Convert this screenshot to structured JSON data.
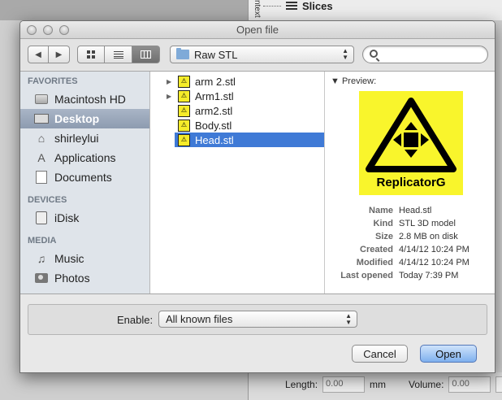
{
  "background": {
    "slices_label": "Slices",
    "vertical_tab": "ntext",
    "length_label": "Length:",
    "length_value": "0.00",
    "length_unit": "mm",
    "volume_label": "Volume:",
    "volume_value": "0.00",
    "cut_text": "cr"
  },
  "dialog": {
    "title": "Open file",
    "location": "Raw STL",
    "search_placeholder": ""
  },
  "sidebar": {
    "sections": [
      {
        "heading": "FAVORITES",
        "items": [
          "Macintosh HD",
          "Desktop",
          "shirleylui",
          "Applications",
          "Documents"
        ]
      },
      {
        "heading": "DEVICES",
        "items": [
          "iDisk"
        ]
      },
      {
        "heading": "MEDIA",
        "items": [
          "Music",
          "Photos"
        ]
      }
    ]
  },
  "files": [
    {
      "name": "arm 2.stl",
      "expandable": true
    },
    {
      "name": "Arm1.stl",
      "expandable": true
    },
    {
      "name": "arm2.stl",
      "expandable": false
    },
    {
      "name": "Body.stl",
      "expandable": false
    },
    {
      "name": "Head.stl",
      "expandable": false,
      "selected": true
    }
  ],
  "preview": {
    "label": "Preview:",
    "image_text": "ReplicatorG",
    "meta": [
      {
        "key": "Name",
        "value": "Head.stl"
      },
      {
        "key": "Kind",
        "value": "STL 3D model"
      },
      {
        "key": "Size",
        "value": "2.8 MB on disk"
      },
      {
        "key": "Created",
        "value": "4/14/12 10:24 PM"
      },
      {
        "key": "Modified",
        "value": "4/14/12 10:24 PM"
      },
      {
        "key": "Last opened",
        "value": "Today 7:39 PM"
      }
    ]
  },
  "filter": {
    "label": "Enable:",
    "value": "All known files"
  },
  "buttons": {
    "cancel": "Cancel",
    "open": "Open"
  },
  "colors": {
    "selection": "#3f7ad6",
    "sidebar_selection": "#9aa7ba",
    "stl_icon": "#f5ec2a",
    "default_button": "#7fb0ee"
  }
}
